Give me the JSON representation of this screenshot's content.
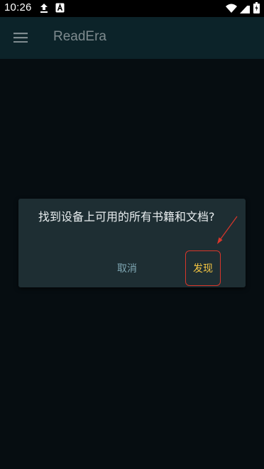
{
  "status_bar": {
    "time": "10:26",
    "icons": [
      "upload-icon",
      "a-badge-icon",
      "wifi-icon",
      "cellular-signal-icon",
      "battery-icon"
    ]
  },
  "app_bar": {
    "title": "ReadEra",
    "menu_icon": "menu-icon",
    "background": "#0c2329",
    "title_color": "#7f8b8f"
  },
  "dialog": {
    "message": "找到设备上可用的所有书籍和文档?",
    "cancel_label": "取消",
    "confirm_label": "发现",
    "background": "#1e2e33",
    "cancel_color": "#7fa7b3",
    "confirm_color": "#f4c542"
  },
  "annotation": {
    "highlight_color": "#d9362b"
  },
  "colors": {
    "page_background": "#060d11",
    "status_bar": "#000000"
  }
}
